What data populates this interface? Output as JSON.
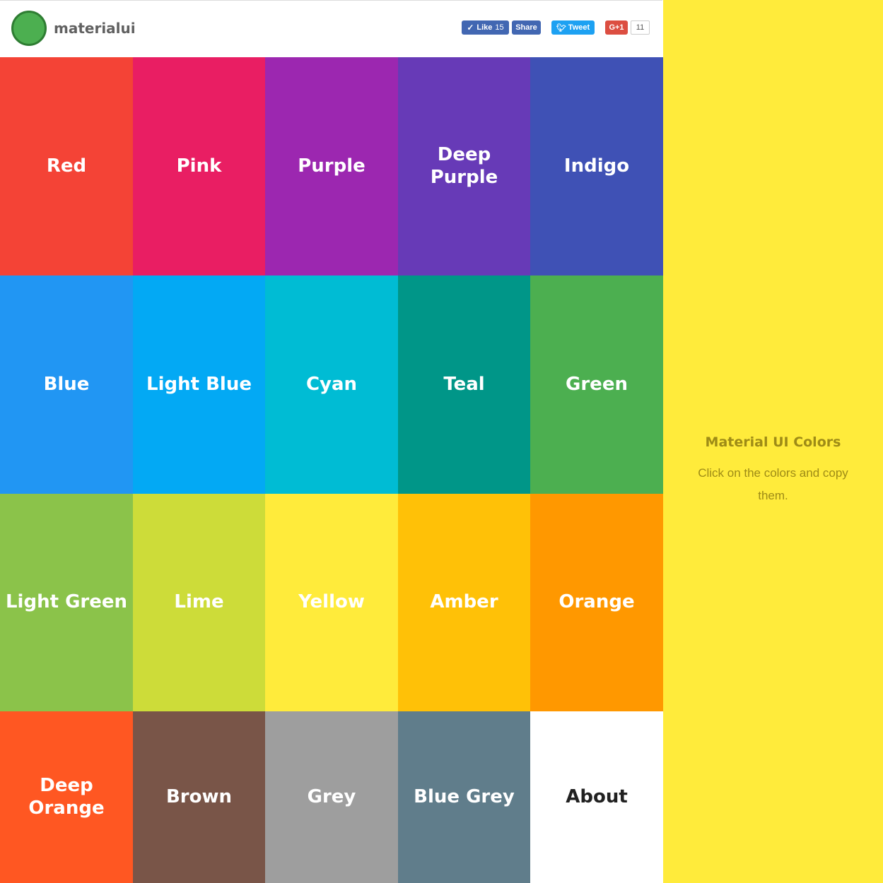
{
  "colors": {
    "sidebar_bg": "#ffeb3b",
    "sidebar_text": "#9e8b16"
  },
  "header": {
    "brand": "materialui",
    "social": {
      "like_label": "Like",
      "like_count": "15",
      "share_label": "Share",
      "tweet_label": "Tweet",
      "gplus_label": "G+1",
      "gplus_count": "11"
    }
  },
  "tiles": [
    {
      "label": "Red",
      "color": "#f44336"
    },
    {
      "label": "Pink",
      "color": "#e91e63"
    },
    {
      "label": "Purple",
      "color": "#9c27b0"
    },
    {
      "label": "Deep Purple",
      "color": "#673ab7"
    },
    {
      "label": "Indigo",
      "color": "#3f51b5"
    },
    {
      "label": "Blue",
      "color": "#2196f3"
    },
    {
      "label": "Light Blue",
      "color": "#03a9f4"
    },
    {
      "label": "Cyan",
      "color": "#00bcd4"
    },
    {
      "label": "Teal",
      "color": "#009688"
    },
    {
      "label": "Green",
      "color": "#4caf50"
    },
    {
      "label": "Light Green",
      "color": "#8bc34a"
    },
    {
      "label": "Lime",
      "color": "#cddc39"
    },
    {
      "label": "Yellow",
      "color": "#ffeb3b"
    },
    {
      "label": "Amber",
      "color": "#ffc107"
    },
    {
      "label": "Orange",
      "color": "#ff9800"
    },
    {
      "label": "Deep Orange",
      "color": "#ff5722"
    },
    {
      "label": "Brown",
      "color": "#795548"
    },
    {
      "label": "Grey",
      "color": "#9e9e9e"
    },
    {
      "label": "Blue Grey",
      "color": "#607d8b"
    },
    {
      "label": "About",
      "color": "#ffffff"
    }
  ],
  "sidebar": {
    "title": "Material UI Colors",
    "description": "Click on the colors and copy them."
  }
}
